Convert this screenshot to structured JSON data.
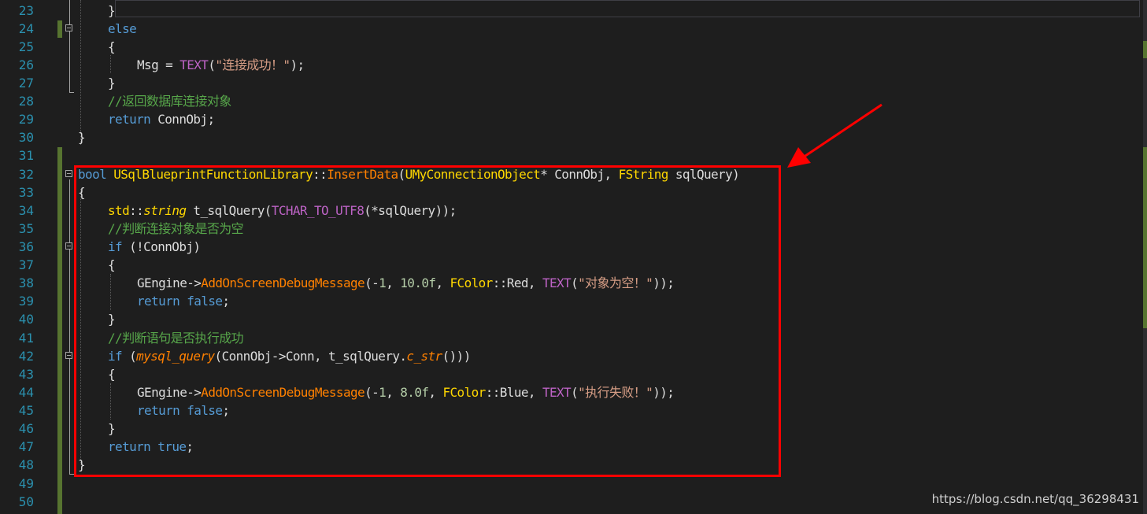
{
  "editor": {
    "lines": [
      {
        "n": "23",
        "code": "}"
      },
      {
        "n": "24",
        "code": "else"
      },
      {
        "n": "25",
        "code": "{"
      },
      {
        "n": "26",
        "code": "Msg = TEXT(\"连接成功！\");"
      },
      {
        "n": "27",
        "code": "}"
      },
      {
        "n": "28",
        "code": "//返回数据库连接对象"
      },
      {
        "n": "29",
        "code": "return ConnObj;"
      },
      {
        "n": "30",
        "code": "}"
      },
      {
        "n": "31",
        "code": ""
      },
      {
        "n": "32",
        "code": "bool USqlBlueprintFunctionLibrary::InsertData(UMyConnectionObject* ConnObj, FString sqlQuery)"
      },
      {
        "n": "33",
        "code": "{"
      },
      {
        "n": "34",
        "code": "std::string t_sqlQuery(TCHAR_TO_UTF8(*sqlQuery));"
      },
      {
        "n": "35",
        "code": "//判断连接对象是否为空"
      },
      {
        "n": "36",
        "code": "if (!ConnObj)"
      },
      {
        "n": "37",
        "code": "{"
      },
      {
        "n": "38",
        "code": "GEngine->AddOnScreenDebugMessage(-1, 10.0f, FColor::Red, TEXT(\"对象为空！\"));"
      },
      {
        "n": "39",
        "code": "return false;"
      },
      {
        "n": "40",
        "code": "}"
      },
      {
        "n": "41",
        "code": "//判断语句是否执行成功"
      },
      {
        "n": "42",
        "code": "if (mysql_query(ConnObj->Conn, t_sqlQuery.c_str()))"
      },
      {
        "n": "43",
        "code": "{"
      },
      {
        "n": "44",
        "code": "GEngine->AddOnScreenDebugMessage(-1, 8.0f, FColor::Blue, TEXT(\"执行失败！\"));"
      },
      {
        "n": "45",
        "code": "return false;"
      },
      {
        "n": "46",
        "code": "}"
      },
      {
        "n": "47",
        "code": "return true;"
      },
      {
        "n": "48",
        "code": "}"
      },
      {
        "n": "49",
        "code": ""
      },
      {
        "n": "50",
        "code": ""
      }
    ]
  },
  "watermark": "https://blog.csdn.net/qq_36298431",
  "colors": {
    "background": "#1e1e1e",
    "line_number": "#2b91af",
    "keyword": "#569cd6",
    "comment": "#57a64a",
    "string": "#d69d85",
    "function": "#ff8000",
    "macro": "#bd63c5",
    "annotation": "#ff0000",
    "change_bar": "#577430"
  }
}
